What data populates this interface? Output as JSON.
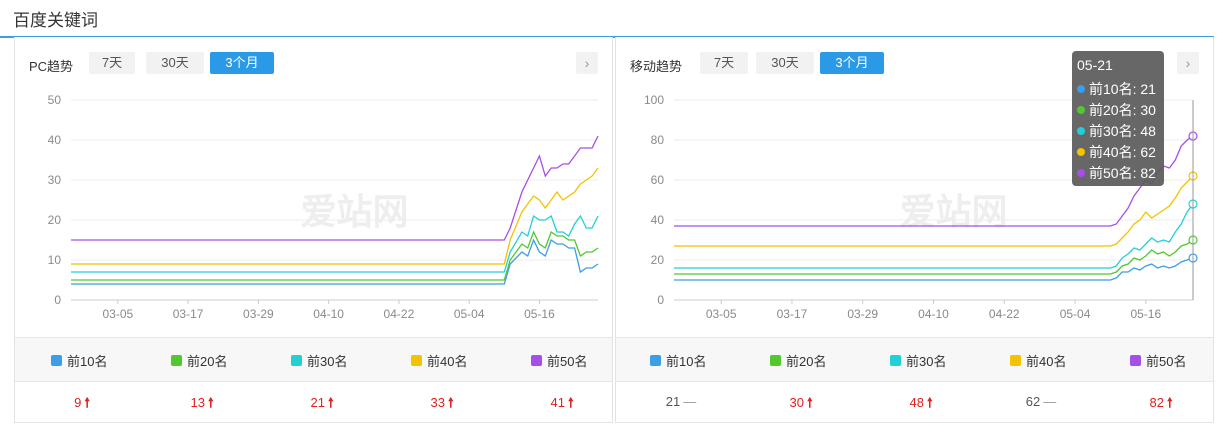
{
  "header": {
    "title": "百度关键词"
  },
  "watermark": "爱站网",
  "tabs": [
    "7天",
    "30天",
    "3个月"
  ],
  "active_tab": "3个月",
  "legend": [
    {
      "label": "前10名",
      "color": "#3c9de8"
    },
    {
      "label": "前20名",
      "color": "#52c72e"
    },
    {
      "label": "前30名",
      "color": "#22cfd6"
    },
    {
      "label": "前40名",
      "color": "#f3c200"
    },
    {
      "label": "前50名",
      "color": "#a54fe8"
    }
  ],
  "pc": {
    "title": "PC趋势",
    "values": [
      {
        "value": "9",
        "trend": "up"
      },
      {
        "value": "13",
        "trend": "up"
      },
      {
        "value": "21",
        "trend": "up"
      },
      {
        "value": "33",
        "trend": "up"
      },
      {
        "value": "41",
        "trend": "up"
      }
    ]
  },
  "mobile": {
    "title": "移动趋势",
    "values": [
      {
        "value": "21",
        "trend": "flat"
      },
      {
        "value": "30",
        "trend": "up"
      },
      {
        "value": "48",
        "trend": "up"
      },
      {
        "value": "62",
        "trend": "flat"
      },
      {
        "value": "82",
        "trend": "up"
      }
    ],
    "tooltip": {
      "date": "05-21",
      "rows": [
        "前10名: 21",
        "前20名: 30",
        "前30名: 48",
        "前40名: 62",
        "前50名: 82"
      ]
    }
  },
  "chart_data": [
    {
      "type": "line",
      "ylim": [
        0,
        50
      ],
      "yticks": [
        0,
        10,
        20,
        30,
        40,
        50
      ],
      "x_tick_labels": [
        "03-05",
        "03-17",
        "03-29",
        "04-10",
        "04-22",
        "05-04",
        "05-16"
      ],
      "x_tick_days": [
        8,
        20,
        32,
        44,
        56,
        68,
        80
      ],
      "x_range_days": [
        0,
        90
      ],
      "series": [
        {
          "name": "前10名",
          "color": "#3c9de8",
          "points": [
            [
              0,
              4
            ],
            [
              74,
              4
            ],
            [
              75,
              9
            ],
            [
              77,
              12
            ],
            [
              78,
              11
            ],
            [
              79,
              15
            ],
            [
              80,
              12
            ],
            [
              81,
              11
            ],
            [
              82,
              15
            ],
            [
              83,
              14
            ],
            [
              84,
              14
            ],
            [
              85,
              13
            ],
            [
              86,
              13
            ],
            [
              87,
              7
            ],
            [
              88,
              8
            ],
            [
              89,
              8
            ],
            [
              90,
              9
            ]
          ]
        },
        {
          "name": "前20名",
          "color": "#52c72e",
          "points": [
            [
              0,
              5
            ],
            [
              74,
              5
            ],
            [
              75,
              10
            ],
            [
              77,
              14
            ],
            [
              78,
              13
            ],
            [
              79,
              17
            ],
            [
              80,
              14
            ],
            [
              81,
              13
            ],
            [
              82,
              17
            ],
            [
              83,
              16
            ],
            [
              84,
              16
            ],
            [
              85,
              15
            ],
            [
              86,
              15
            ],
            [
              87,
              11
            ],
            [
              88,
              12
            ],
            [
              89,
              12
            ],
            [
              90,
              13
            ]
          ]
        },
        {
          "name": "前30名",
          "color": "#22cfd6",
          "points": [
            [
              0,
              7
            ],
            [
              74,
              7
            ],
            [
              75,
              12
            ],
            [
              77,
              17
            ],
            [
              78,
              16
            ],
            [
              79,
              21
            ],
            [
              80,
              20
            ],
            [
              81,
              20
            ],
            [
              82,
              21
            ],
            [
              83,
              17
            ],
            [
              84,
              17
            ],
            [
              85,
              16
            ],
            [
              86,
              19
            ],
            [
              87,
              21
            ],
            [
              88,
              18
            ],
            [
              89,
              18
            ],
            [
              90,
              21
            ]
          ]
        },
        {
          "name": "前40名",
          "color": "#f3c200",
          "points": [
            [
              0,
              9
            ],
            [
              74,
              9
            ],
            [
              75,
              15
            ],
            [
              77,
              22
            ],
            [
              78,
              24
            ],
            [
              79,
              26
            ],
            [
              80,
              25
            ],
            [
              81,
              23
            ],
            [
              82,
              25
            ],
            [
              83,
              27
            ],
            [
              84,
              25
            ],
            [
              85,
              26
            ],
            [
              86,
              27
            ],
            [
              87,
              29
            ],
            [
              88,
              30
            ],
            [
              89,
              31
            ],
            [
              90,
              33
            ]
          ]
        },
        {
          "name": "前50名",
          "color": "#a54fe8",
          "points": [
            [
              0,
              15
            ],
            [
              74,
              15
            ],
            [
              75,
              18
            ],
            [
              77,
              27
            ],
            [
              78,
              30
            ],
            [
              79,
              33
            ],
            [
              80,
              36
            ],
            [
              81,
              31
            ],
            [
              82,
              33
            ],
            [
              83,
              33
            ],
            [
              84,
              34
            ],
            [
              85,
              34
            ],
            [
              86,
              36
            ],
            [
              87,
              38
            ],
            [
              88,
              38
            ],
            [
              89,
              38
            ],
            [
              90,
              41
            ]
          ]
        }
      ]
    },
    {
      "type": "line",
      "ylim": [
        0,
        100
      ],
      "yticks": [
        0,
        20,
        40,
        60,
        80,
        100
      ],
      "x_tick_labels": [
        "03-05",
        "03-17",
        "03-29",
        "04-10",
        "04-22",
        "05-04",
        "05-16"
      ],
      "x_tick_days": [
        8,
        20,
        32,
        44,
        56,
        68,
        80
      ],
      "x_range_days": [
        0,
        88
      ],
      "series": [
        {
          "name": "前10名",
          "color": "#3c9de8",
          "points": [
            [
              0,
              10
            ],
            [
              74,
              10
            ],
            [
              75,
              11
            ],
            [
              76,
              14
            ],
            [
              77,
              14
            ],
            [
              78,
              16
            ],
            [
              79,
              15
            ],
            [
              80,
              17
            ],
            [
              81,
              18
            ],
            [
              82,
              16
            ],
            [
              83,
              17
            ],
            [
              84,
              16
            ],
            [
              85,
              17
            ],
            [
              86,
              19
            ],
            [
              87,
              20
            ],
            [
              88,
              21
            ]
          ]
        },
        {
          "name": "前20名",
          "color": "#52c72e",
          "points": [
            [
              0,
              13
            ],
            [
              74,
              13
            ],
            [
              75,
              14
            ],
            [
              76,
              17
            ],
            [
              77,
              18
            ],
            [
              78,
              21
            ],
            [
              79,
              20
            ],
            [
              80,
              22
            ],
            [
              81,
              25
            ],
            [
              82,
              23
            ],
            [
              83,
              24
            ],
            [
              84,
              22
            ],
            [
              85,
              24
            ],
            [
              86,
              27
            ],
            [
              87,
              28
            ],
            [
              88,
              30
            ]
          ]
        },
        {
          "name": "前30名",
          "color": "#22cfd6",
          "points": [
            [
              0,
              16
            ],
            [
              74,
              16
            ],
            [
              75,
              17
            ],
            [
              76,
              21
            ],
            [
              77,
              23
            ],
            [
              78,
              26
            ],
            [
              79,
              25
            ],
            [
              80,
              28
            ],
            [
              81,
              31
            ],
            [
              82,
              29
            ],
            [
              83,
              30
            ],
            [
              84,
              29
            ],
            [
              85,
              34
            ],
            [
              86,
              38
            ],
            [
              87,
              44
            ],
            [
              88,
              48
            ]
          ]
        },
        {
          "name": "前40名",
          "color": "#f3c200",
          "points": [
            [
              0,
              27
            ],
            [
              74,
              27
            ],
            [
              75,
              28
            ],
            [
              76,
              31
            ],
            [
              77,
              34
            ],
            [
              78,
              38
            ],
            [
              79,
              40
            ],
            [
              80,
              44
            ],
            [
              81,
              41
            ],
            [
              82,
              43
            ],
            [
              83,
              45
            ],
            [
              84,
              47
            ],
            [
              85,
              51
            ],
            [
              86,
              56
            ],
            [
              87,
              59
            ],
            [
              88,
              62
            ]
          ]
        },
        {
          "name": "前50名",
          "color": "#a54fe8",
          "points": [
            [
              0,
              37
            ],
            [
              74,
              37
            ],
            [
              75,
              38
            ],
            [
              76,
              42
            ],
            [
              77,
              46
            ],
            [
              78,
              52
            ],
            [
              79,
              56
            ],
            [
              80,
              60
            ],
            [
              81,
              58
            ],
            [
              82,
              64
            ],
            [
              83,
              67
            ],
            [
              84,
              66
            ],
            [
              85,
              70
            ],
            [
              86,
              77
            ],
            [
              87,
              80
            ],
            [
              88,
              82
            ]
          ]
        }
      ],
      "highlight_index_last": true
    }
  ]
}
